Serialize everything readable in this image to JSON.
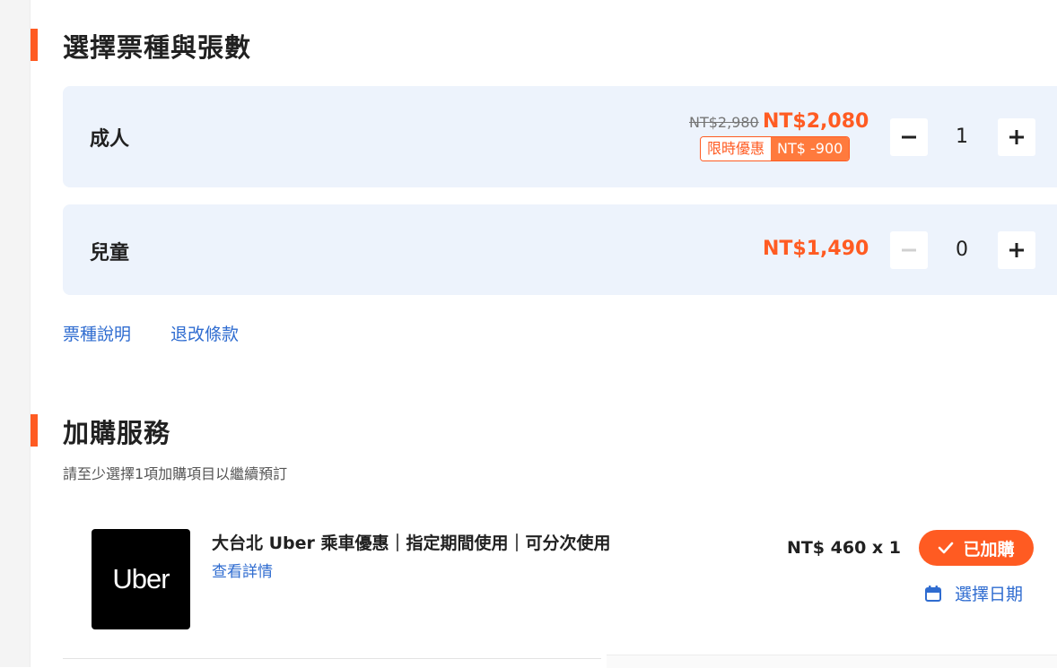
{
  "tickets_section": {
    "title": "選擇票種與張數",
    "tickets": [
      {
        "name": "成人",
        "original_price": "NT$2,980",
        "price": "NT$2,080",
        "promo_label": "限時優惠",
        "promo_amount": "NT$ -900",
        "quantity": "1",
        "minus_enabled": true
      },
      {
        "name": "兒童",
        "price": "NT$1,490",
        "quantity": "0",
        "minus_enabled": false
      }
    ],
    "links": [
      "票種說明",
      "退改條款"
    ]
  },
  "addons_section": {
    "title": "加購服務",
    "hint": "請至少選擇1項加購項目以繼續預訂",
    "item": {
      "logo_text": "Uber",
      "title": "大台北 Uber 乘車優惠｜指定期間使用｜可分次使用",
      "details_link": "查看詳情",
      "price": "NT$ 460 x 1",
      "added_label": "已加購",
      "choose_date_label": "選擇日期"
    }
  },
  "colors": {
    "accent": "#ff5b22",
    "link": "#2f6cd0",
    "card_bg": "#edf3fc"
  },
  "icons": {
    "minus": "minus-icon",
    "plus": "plus-icon",
    "check": "check-icon",
    "calendar": "calendar-icon"
  }
}
